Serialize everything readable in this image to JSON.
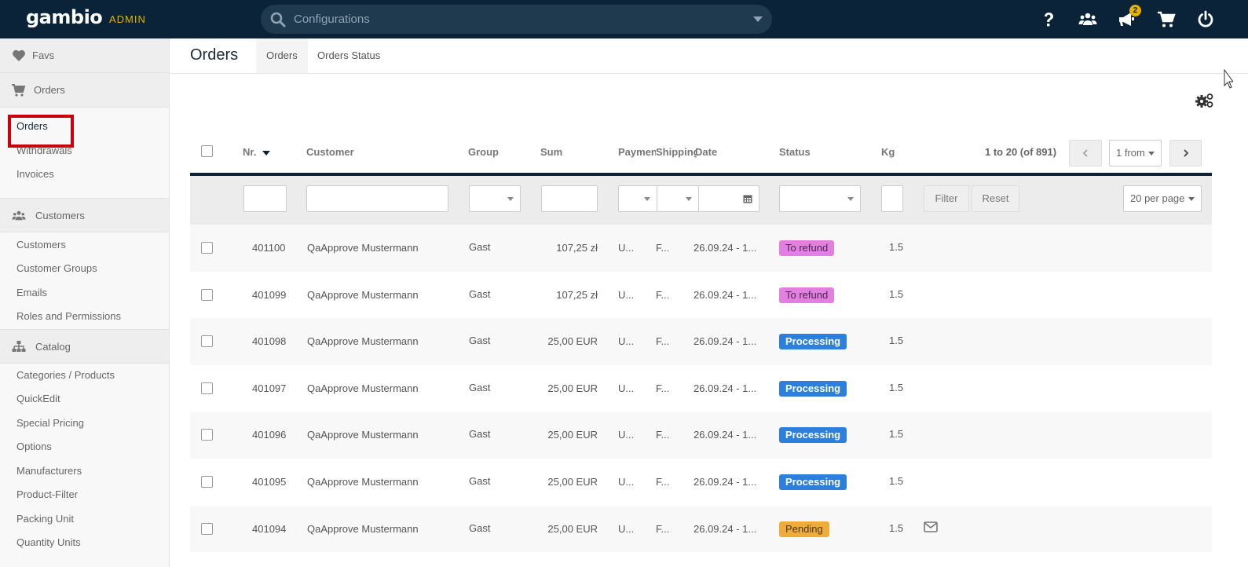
{
  "header": {
    "logo": "gambio",
    "logo_tag": "ADMIN",
    "search_placeholder": "Configurations",
    "notification_count": "2",
    "icons": [
      "help-icon",
      "users-icon",
      "megaphone-icon",
      "cart-icon",
      "power-icon"
    ]
  },
  "sidebar": {
    "favs": "Favs",
    "orders_section": "Orders",
    "orders_items": [
      "Orders",
      "Withdrawals",
      "Invoices"
    ],
    "customers_section": "Customers",
    "customers_items": [
      "Customers",
      "Customer Groups",
      "Emails",
      "Roles and Permissions"
    ],
    "catalog_section": "Catalog",
    "catalog_items": [
      "Categories / Products",
      "QuickEdit",
      "Special Pricing",
      "Options",
      "Manufacturers",
      "Product-Filter",
      "Packing Unit",
      "Quantity Units"
    ]
  },
  "page": {
    "title": "Orders",
    "tabs": [
      "Orders",
      "Orders Status"
    ]
  },
  "table": {
    "columns": [
      "Nr.",
      "Customer",
      "Group",
      "Sum",
      "Payment",
      "Shipping",
      "Date",
      "Status",
      "Kg"
    ],
    "pager_info": "1 to 20 (of 891)",
    "page_select": "1 from",
    "per_page": "20 per page",
    "filter_label": "Filter",
    "reset_label": "Reset",
    "rows": [
      {
        "nr": "401100",
        "customer": "QaApprove Mustermann",
        "group": "Gast",
        "sum": "107,25 zł",
        "payment": "U...",
        "shipping": "F...",
        "date": "26.09.24 - 1...",
        "status": "To refund",
        "kg": "1.5",
        "mail": false
      },
      {
        "nr": "401099",
        "customer": "QaApprove Mustermann",
        "group": "Gast",
        "sum": "107,25 zł",
        "payment": "U...",
        "shipping": "F...",
        "date": "26.09.24 - 1...",
        "status": "To refund",
        "kg": "1.5",
        "mail": false
      },
      {
        "nr": "401098",
        "customer": "QaApprove Mustermann",
        "group": "Gast",
        "sum": "25,00 EUR",
        "payment": "U...",
        "shipping": "F...",
        "date": "26.09.24 - 1...",
        "status": "Processing",
        "kg": "1.5",
        "mail": false
      },
      {
        "nr": "401097",
        "customer": "QaApprove Mustermann",
        "group": "Gast",
        "sum": "25,00 EUR",
        "payment": "U...",
        "shipping": "F...",
        "date": "26.09.24 - 1...",
        "status": "Processing",
        "kg": "1.5",
        "mail": false
      },
      {
        "nr": "401096",
        "customer": "QaApprove Mustermann",
        "group": "Gast",
        "sum": "25,00 EUR",
        "payment": "U...",
        "shipping": "F...",
        "date": "26.09.24 - 1...",
        "status": "Processing",
        "kg": "1.5",
        "mail": false
      },
      {
        "nr": "401095",
        "customer": "QaApprove Mustermann",
        "group": "Gast",
        "sum": "25,00 EUR",
        "payment": "U...",
        "shipping": "F...",
        "date": "26.09.24 - 1...",
        "status": "Processing",
        "kg": "1.5",
        "mail": false
      },
      {
        "nr": "401094",
        "customer": "QaApprove Mustermann",
        "group": "Gast",
        "sum": "25,00 EUR",
        "payment": "U...",
        "shipping": "F...",
        "date": "26.09.24 - 1...",
        "status": "Pending",
        "kg": "1.5",
        "mail": true
      }
    ]
  },
  "status_colors": {
    "To refund": {
      "bg": "#e27fe0",
      "fg": "#4a2a4a"
    },
    "Processing": {
      "bg": "#2c7fdc",
      "fg": "#ffffff"
    },
    "Pending": {
      "bg": "#efac3a",
      "fg": "#4a3a1a"
    }
  },
  "colors": {
    "topbar": "#0a2339",
    "accent": "#e0b400",
    "highlight": "#c8000c"
  }
}
